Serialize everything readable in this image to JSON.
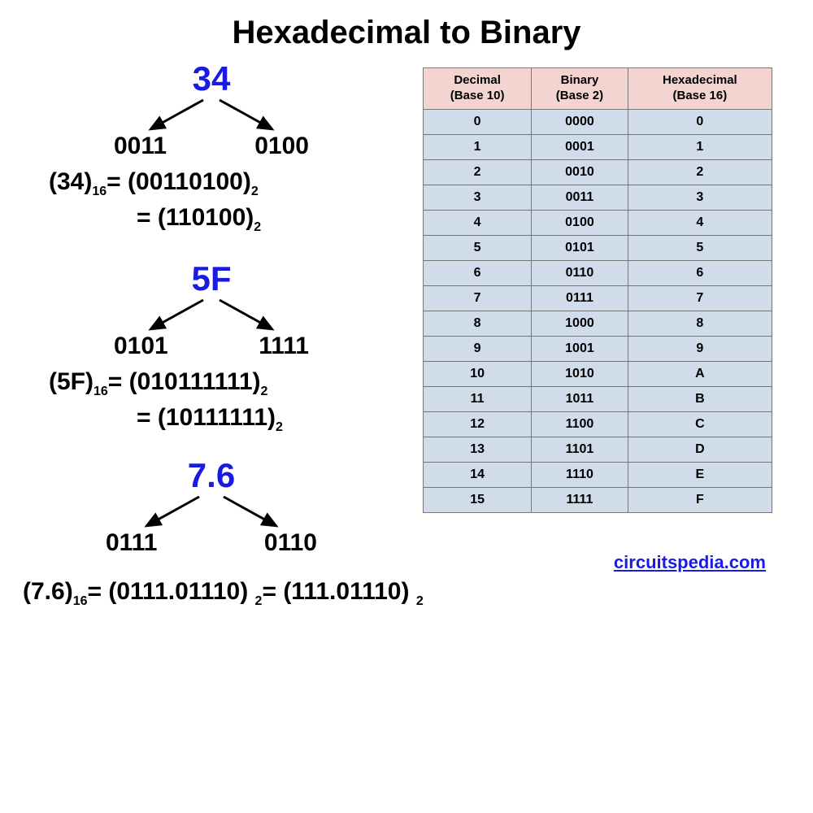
{
  "title": "Hexadecimal to Binary",
  "credit": "circuitspedia.com",
  "examples": {
    "a": {
      "hex": "34",
      "nibble_left": "0011",
      "nibble_right": "0100",
      "src": "(34)",
      "src_base": "16",
      "full": "(00110100)",
      "full_base": "2",
      "trim": "(110100)",
      "trim_base": "2"
    },
    "b": {
      "hex": "5F",
      "nibble_left": "0101",
      "nibble_right": "1111",
      "src": "(5F)",
      "src_base": "16",
      "full": "(010111111)",
      "full_base": "2",
      "trim": "(10111111)",
      "trim_base": "2"
    },
    "c": {
      "hex": "7.6",
      "nibble_left": "0111",
      "nibble_right": "0110",
      "src": "(7.6)",
      "src_base": "16",
      "full": "(0111.01110)",
      "full_base": "2",
      "trim": "(111.01110)",
      "trim_base": "2"
    }
  },
  "table": {
    "headers": {
      "dec_l1": "Decimal",
      "dec_l2": "(Base 10)",
      "bin_l1": "Binary",
      "bin_l2": "(Base 2)",
      "hex_l1": "Hexadecimal",
      "hex_l2": "(Base 16)"
    },
    "rows": [
      {
        "d": "0",
        "b": "0000",
        "h": "0"
      },
      {
        "d": "1",
        "b": "0001",
        "h": "1"
      },
      {
        "d": "2",
        "b": "0010",
        "h": "2"
      },
      {
        "d": "3",
        "b": "0011",
        "h": "3"
      },
      {
        "d": "4",
        "b": "0100",
        "h": "4"
      },
      {
        "d": "5",
        "b": "0101",
        "h": "5"
      },
      {
        "d": "6",
        "b": "0110",
        "h": "6"
      },
      {
        "d": "7",
        "b": "0111",
        "h": "7"
      },
      {
        "d": "8",
        "b": "1000",
        "h": "8"
      },
      {
        "d": "9",
        "b": "1001",
        "h": "9"
      },
      {
        "d": "10",
        "b": "1010",
        "h": "A"
      },
      {
        "d": "11",
        "b": "1011",
        "h": "B"
      },
      {
        "d": "12",
        "b": "1100",
        "h": "C"
      },
      {
        "d": "13",
        "b": "1101",
        "h": "D"
      },
      {
        "d": "14",
        "b": "1110",
        "h": "E"
      },
      {
        "d": "15",
        "b": "1111",
        "h": "F"
      }
    ]
  },
  "chart_data": {
    "type": "table",
    "title": "Hexadecimal to Binary",
    "columns": [
      "Decimal (Base 10)",
      "Binary (Base 2)",
      "Hexadecimal (Base 16)"
    ],
    "rows": [
      [
        0,
        "0000",
        "0"
      ],
      [
        1,
        "0001",
        "1"
      ],
      [
        2,
        "0010",
        "2"
      ],
      [
        3,
        "0011",
        "3"
      ],
      [
        4,
        "0100",
        "4"
      ],
      [
        5,
        "0101",
        "5"
      ],
      [
        6,
        "0110",
        "6"
      ],
      [
        7,
        "0111",
        "7"
      ],
      [
        8,
        "1000",
        "8"
      ],
      [
        9,
        "1001",
        "9"
      ],
      [
        10,
        "1010",
        "A"
      ],
      [
        11,
        "1011",
        "B"
      ],
      [
        12,
        "1100",
        "C"
      ],
      [
        13,
        "1101",
        "D"
      ],
      [
        14,
        "1110",
        "E"
      ],
      [
        15,
        "1111",
        "F"
      ]
    ],
    "examples": [
      {
        "hex": "34",
        "binary_unpadded": "110100",
        "binary_padded": "00110100"
      },
      {
        "hex": "5F",
        "binary_unpadded": "10111111",
        "binary_padded": "010111111"
      },
      {
        "hex": "7.6",
        "binary_unpadded": "111.01110",
        "binary_padded": "0111.01110"
      }
    ]
  }
}
